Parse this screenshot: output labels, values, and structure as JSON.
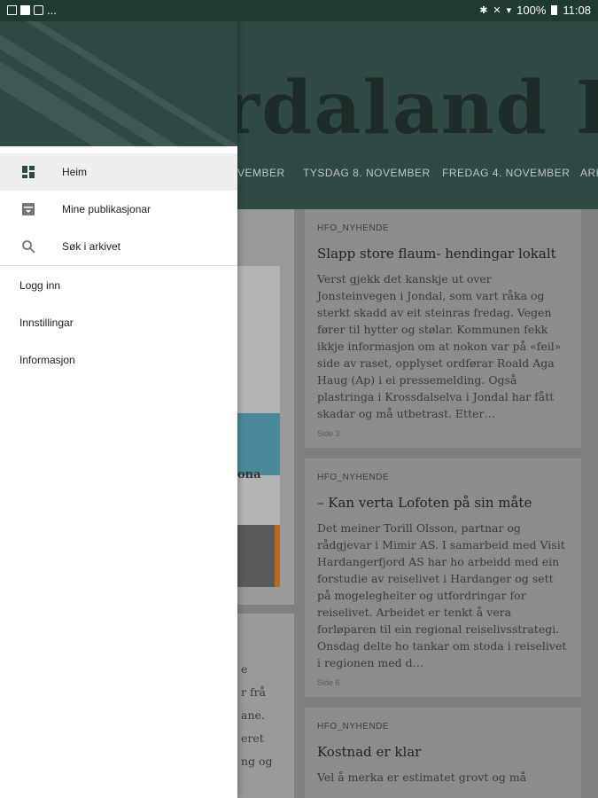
{
  "status_bar": {
    "left_icons": [
      "picture-icon",
      "flipboard-icon",
      "shopping-bag-icon",
      "more-notifications-icon"
    ],
    "more": "...",
    "battery": "100%",
    "time": "11:08"
  },
  "background": {
    "masthead": "rdaland Folk",
    "date_tabs": [
      "VEMBER",
      "TYSDAG 8. NOVEMBER",
      "FREDAG 4. NOVEMBER",
      "ARK"
    ],
    "thumb_word": "ona",
    "articles": [
      {
        "section": "HFO_NYHENDE",
        "headline": "Slapp store flaum- hendingar lokalt",
        "body": "Verst gjekk det kanskje ut over Jonsteinvegen i Jondal, som vart råka og sterkt skadd av eit steinras fredag. Vegen fører til hytter og stølar. Kommunen fekk ikkje informasjon om at nokon var på «feil» side av raset, opplyset ordførar Roald Aga Haug (Ap) i ei pressemelding. Også plastringa i Krossdalselva i Jondal har fått skadar og må utbetrast. Etter…",
        "page": "Side 3"
      },
      {
        "section": "HFO_NYHENDE",
        "headline": "– Kan verta Lofoten på sin måte",
        "body": "Det meiner Torill Olsson, partnar og rådgjevar i Mimir AS. I samarbeid med Visit Hardangerfjord AS har ho arbeidd med ein forstudie av reiselivet i Hardanger og sett på mogelegheiter og utfordringar for reiselivet. Arbeidet er tenkt å vera forløparen til ein regional reiselivsstrategi. Onsdag delte ho tankar om stoda i reiselivet i regionen med d…",
        "page": "Side 6"
      },
      {
        "section": "HFO_NYHENDE",
        "headline": "Kostnad er klar",
        "body": "Vel å merka er estimatet grovt og må",
        "page": ""
      }
    ],
    "left_snippets": [
      "e",
      "r frå",
      "ane.",
      "eret",
      "ng og"
    ]
  },
  "drawer": {
    "items": [
      {
        "label": "Heim",
        "icon": "dashboard-icon",
        "active": true
      },
      {
        "label": "Mine publikasjonar",
        "icon": "archive-box-icon",
        "active": false
      },
      {
        "label": "Søk i arkivet",
        "icon": "search-icon",
        "active": false
      }
    ],
    "secondary": [
      "Logg inn",
      "Innstillingar",
      "Informasjon"
    ]
  },
  "colors": {
    "header_green": "#2f4a45",
    "status_green": "#1f3a33",
    "scrim": "#7f7f7f"
  }
}
